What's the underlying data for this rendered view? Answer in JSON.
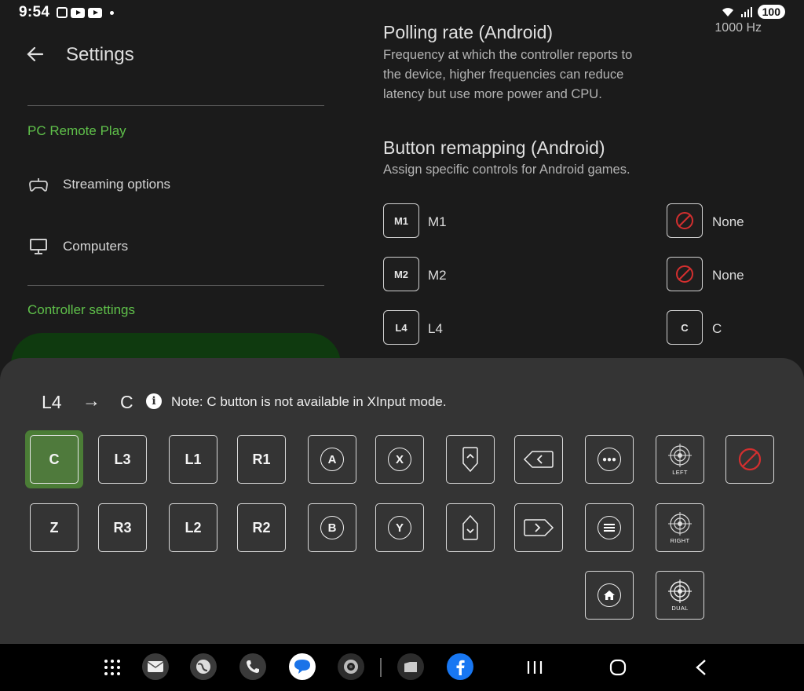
{
  "status_bar": {
    "time": "9:54",
    "battery": "100"
  },
  "polling": {
    "title": "Polling rate (Android)",
    "desc_line1": "Frequency at which the controller reports to",
    "desc_line2": "the device, higher frequencies can reduce",
    "desc_line3": "latency but use more power and CPU.",
    "value": "1000 Hz"
  },
  "left_panel": {
    "title": "Settings",
    "section_pc": "PC Remote Play",
    "streaming": "Streaming options",
    "computers": "Computers",
    "section_controller": "Controller settings"
  },
  "remap": {
    "title": "Button remapping (Android)",
    "desc": "Assign specific controls for Android games.",
    "rows": [
      {
        "from_icon": "M1",
        "from_label": "M1",
        "to_label": "None"
      },
      {
        "from_icon": "M2",
        "from_label": "M2",
        "to_label": "None"
      },
      {
        "from_icon": "L4",
        "from_label": "L4",
        "to_icon": "C",
        "to_label": "C"
      }
    ]
  },
  "sheet": {
    "from": "L4",
    "arrow": "→",
    "to": "C",
    "note": "Note: C button is not available in XInput mode.",
    "keys_row1": [
      "C",
      "L3",
      "L1",
      "R1",
      "A",
      "X"
    ],
    "keys_row2": [
      "Z",
      "R3",
      "L2",
      "R2",
      "B",
      "Y"
    ],
    "target_left": "LEFT",
    "target_right": "RIGHT",
    "target_dual": "DUAL"
  },
  "colors": {
    "accent_green": "#5fc04a",
    "selected_key": "#4f7a3c",
    "forbid_red": "#d32f2f"
  }
}
